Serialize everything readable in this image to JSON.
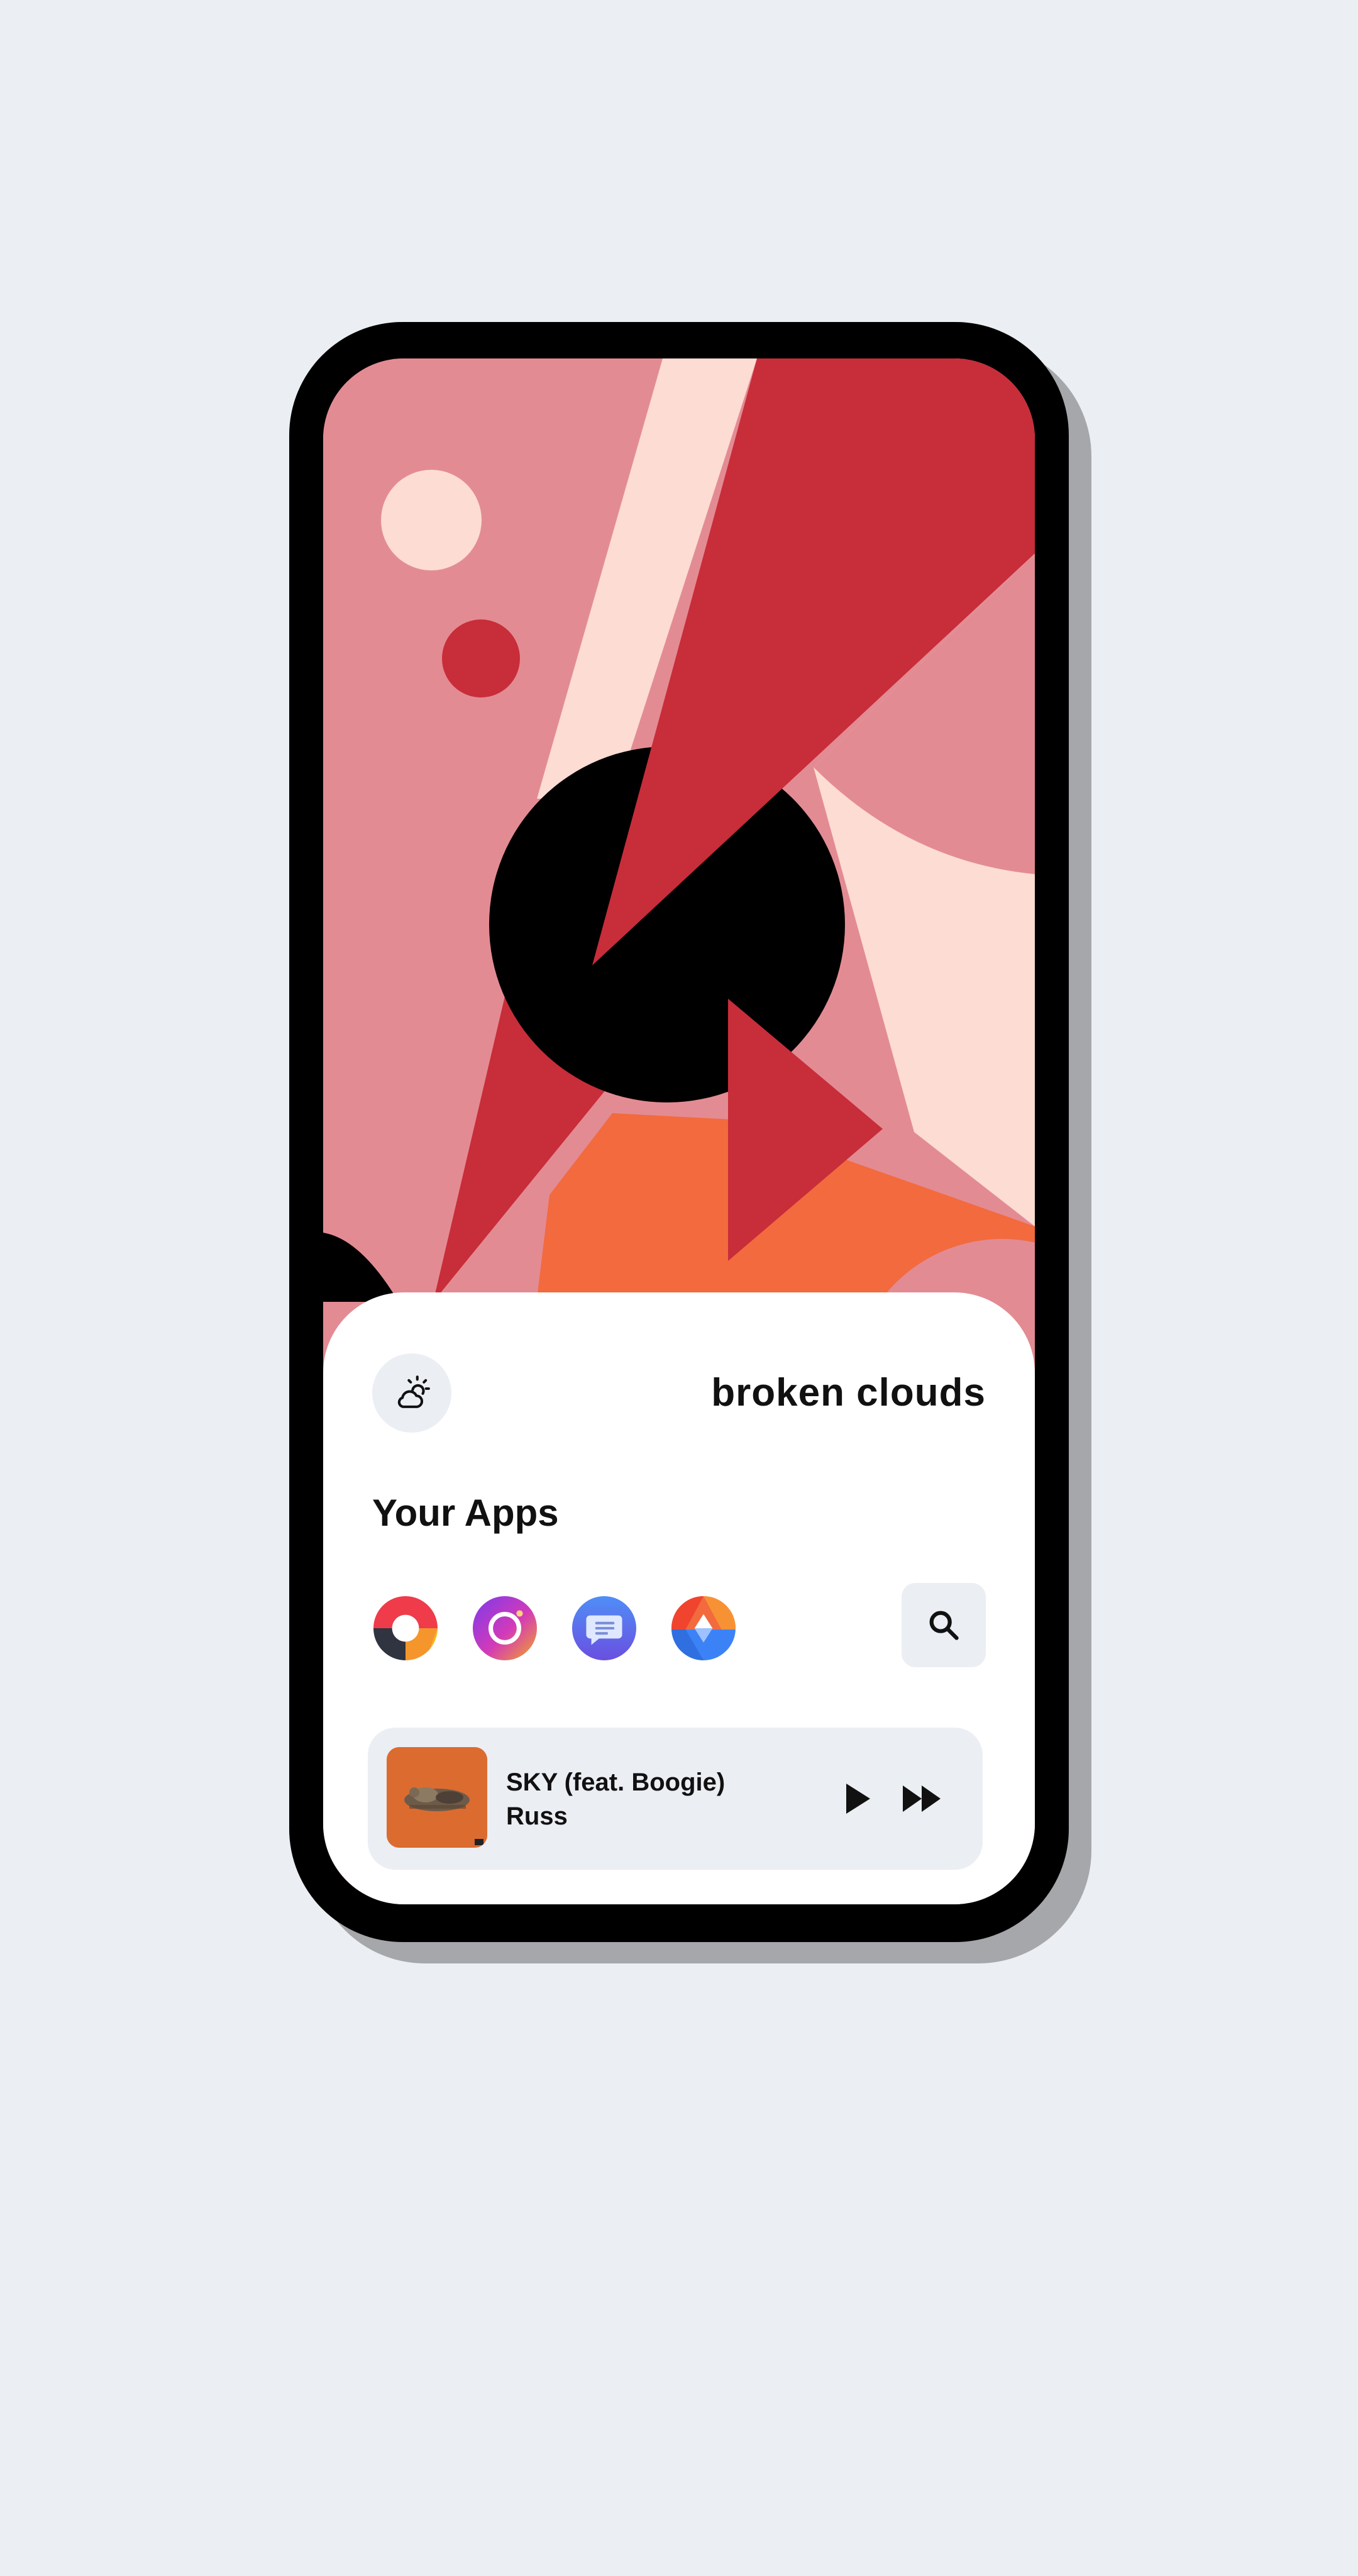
{
  "weather": {
    "description": "broken clouds",
    "icon": "partly-cloudy-icon"
  },
  "apps": {
    "title": "Your Apps",
    "items": [
      {
        "name": "Chrome",
        "icon": "chrome-icon"
      },
      {
        "name": "Instagram",
        "icon": "instagram-icon"
      },
      {
        "name": "Messages",
        "icon": "messages-icon"
      },
      {
        "name": "Inbox",
        "icon": "inbox-icon"
      }
    ],
    "search_icon": "search-icon"
  },
  "player": {
    "track_title": "SKY (feat. Boogie)",
    "artist": "Russ",
    "play_icon": "play-icon",
    "next_icon": "fast-forward-icon"
  },
  "colors": {
    "background": "#ebeef3",
    "wallpaper_pink": "#e38b93",
    "wallpaper_red": "#c82d3a",
    "wallpaper_cream": "#fcdcd3",
    "wallpaper_orange": "#f26a3e",
    "panel": "#ffffff",
    "chip": "#ebeef3"
  }
}
